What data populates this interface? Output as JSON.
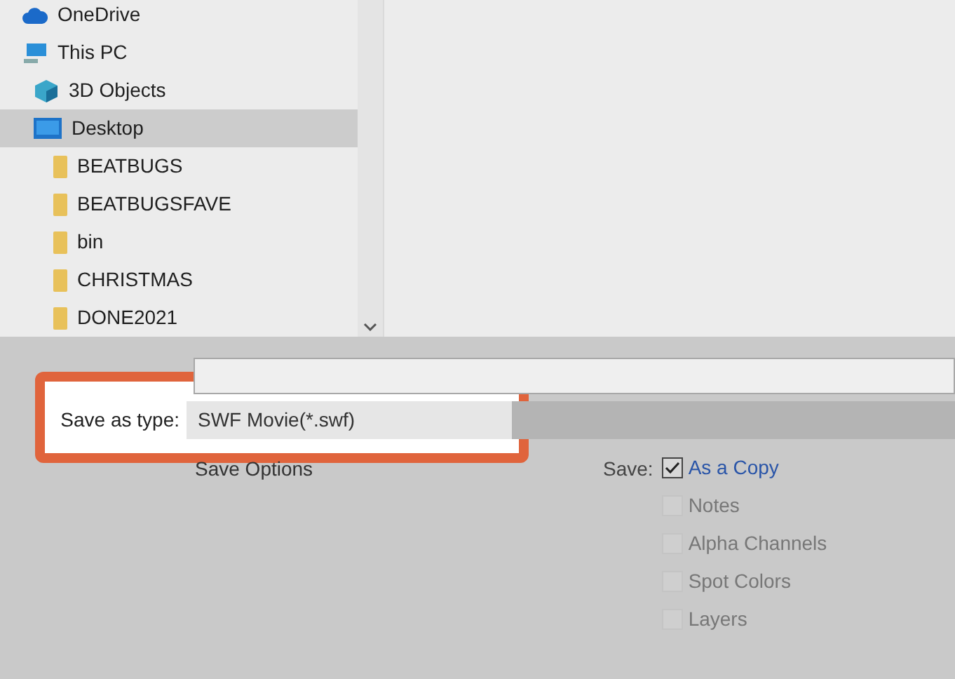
{
  "nav_tree": [
    {
      "label": "OneDrive",
      "kind": "cloud",
      "selected": false
    },
    {
      "label": "This PC",
      "kind": "pc",
      "selected": false,
      "children": [
        {
          "label": "3D Objects",
          "kind": "cube",
          "selected": false
        },
        {
          "label": "Desktop",
          "kind": "desktop",
          "selected": true,
          "children": [
            {
              "label": "BEATBUGS",
              "kind": "folder",
              "selected": false
            },
            {
              "label": "BEATBUGSFAVE",
              "kind": "folder",
              "selected": false
            },
            {
              "label": "bin",
              "kind": "folder",
              "selected": false
            },
            {
              "label": "CHRISTMAS",
              "kind": "folder",
              "selected": false
            },
            {
              "label": "DONE2021",
              "kind": "folder",
              "selected": false
            }
          ]
        }
      ]
    }
  ],
  "save_as_type": {
    "label": "Save as type:",
    "value": "SWF Movie(*.swf)"
  },
  "save_options": {
    "heading": "Save Options",
    "save_label": "Save:",
    "checkboxes": [
      {
        "label": "As a Copy",
        "checked": true,
        "disabled": false
      },
      {
        "label": "Notes",
        "checked": false,
        "disabled": true
      },
      {
        "label": "Alpha Channels",
        "checked": false,
        "disabled": true
      },
      {
        "label": "Spot Colors",
        "checked": false,
        "disabled": true
      },
      {
        "label": "Layers",
        "checked": false,
        "disabled": true
      }
    ]
  }
}
